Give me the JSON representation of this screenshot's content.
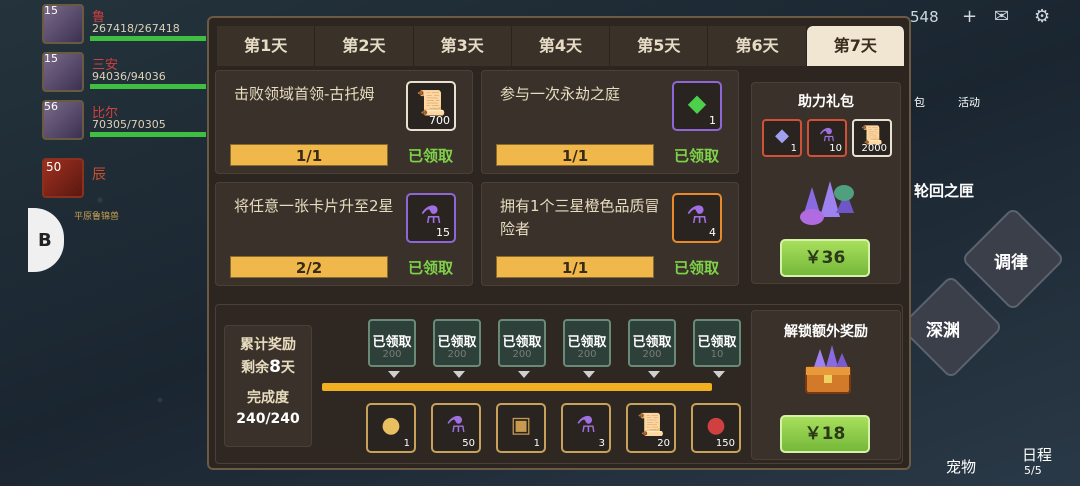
{
  "background": {
    "party": [
      {
        "level": "15",
        "name": "鲁",
        "hp": "267418/267418"
      },
      {
        "level": "15",
        "name": "三安",
        "hp": "94036/94036"
      },
      {
        "level": "56",
        "name": "比尔",
        "hp": "70305/70305"
      }
    ],
    "boss": {
      "level": "50",
      "name": "辰",
      "sub": "平原鲁锦兽"
    },
    "side_tab_icon": "B",
    "top_counter": "548",
    "side_menu": [
      "轮回之匣",
      "调律",
      "深渊",
      "宠物",
      "日程"
    ],
    "side_menu_misc": [
      "包",
      "活动"
    ],
    "schedule_count": "5/5"
  },
  "tabs": [
    {
      "label": "第1天",
      "active": false
    },
    {
      "label": "第2天",
      "active": false
    },
    {
      "label": "第3天",
      "active": false
    },
    {
      "label": "第4天",
      "active": false
    },
    {
      "label": "第5天",
      "active": false
    },
    {
      "label": "第6天",
      "active": false
    },
    {
      "label": "第7天",
      "active": true
    }
  ],
  "tasks": [
    {
      "title": "击败领域首领-古托姆",
      "item_icon": "scroll-icon",
      "item_count": "700",
      "item_border": "white",
      "progress": "1/1",
      "status": "已领取"
    },
    {
      "title": "参与一次永劫之庭",
      "item_icon": "green-crystal-icon",
      "item_count": "1",
      "item_border": "purple",
      "progress": "1/1",
      "status": "已领取"
    },
    {
      "title": "将任意一张卡片升至2星",
      "item_icon": "purple-potion-icon",
      "item_count": "15",
      "item_border": "purple",
      "progress": "2/2",
      "status": "已领取"
    },
    {
      "title": "拥有1个三星橙色品质冒险者",
      "item_icon": "purple-potion-icon",
      "item_count": "4",
      "item_border": "orange",
      "progress": "1/1",
      "status": "已领取"
    }
  ],
  "gift_pack": {
    "title": "助力礼包",
    "items": [
      {
        "icon": "crystal-icon",
        "count": "1"
      },
      {
        "icon": "purple-potion-icon",
        "count": "10"
      },
      {
        "icon": "scroll-icon",
        "count": "2000"
      }
    ],
    "price": "￥36"
  },
  "cumulative": {
    "label": "累计奖励",
    "remaining_prefix": "剩余",
    "remaining_days": "8",
    "remaining_suffix": "天",
    "completion_label": "完成度",
    "completion": "240/240"
  },
  "milestones": [
    {
      "status": "已领取",
      "points": "200"
    },
    {
      "status": "已领取",
      "points": "200"
    },
    {
      "status": "已领取",
      "points": "200"
    },
    {
      "status": "已领取",
      "points": "200"
    },
    {
      "status": "已领取",
      "points": "200"
    },
    {
      "status": "已领取",
      "points": "10"
    }
  ],
  "milestone_rewards": [
    {
      "icon": "egg-icon",
      "count": "1"
    },
    {
      "icon": "purple-potion-icon",
      "count": "50"
    },
    {
      "icon": "chest-icon",
      "count": "1"
    },
    {
      "icon": "purple-potion-icon",
      "count": "3"
    },
    {
      "icon": "scroll-icon",
      "count": "20"
    },
    {
      "icon": "red-orb-icon",
      "count": "150"
    }
  ],
  "unlock": {
    "title": "解锁额外奖励",
    "price": "￥18"
  }
}
